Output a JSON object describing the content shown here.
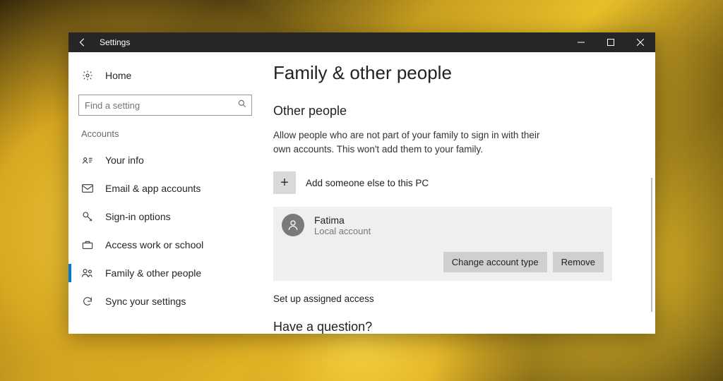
{
  "titlebar": {
    "title": "Settings"
  },
  "sidebar": {
    "home": "Home",
    "search_placeholder": "Find a setting",
    "section": "Accounts",
    "items": [
      {
        "label": "Your info"
      },
      {
        "label": "Email & app accounts"
      },
      {
        "label": "Sign-in options"
      },
      {
        "label": "Access work or school"
      },
      {
        "label": "Family & other people"
      },
      {
        "label": "Sync your settings"
      }
    ]
  },
  "main": {
    "heading": "Family & other people",
    "section": "Other people",
    "description": "Allow people who are not part of your family to sign in with their own accounts. This won't add them to your family.",
    "add_label": "Add someone else to this PC",
    "user": {
      "name": "Fatima",
      "type": "Local account",
      "change_btn": "Change account type",
      "remove_btn": "Remove"
    },
    "assigned": "Set up assigned access",
    "question": "Have a question?"
  }
}
